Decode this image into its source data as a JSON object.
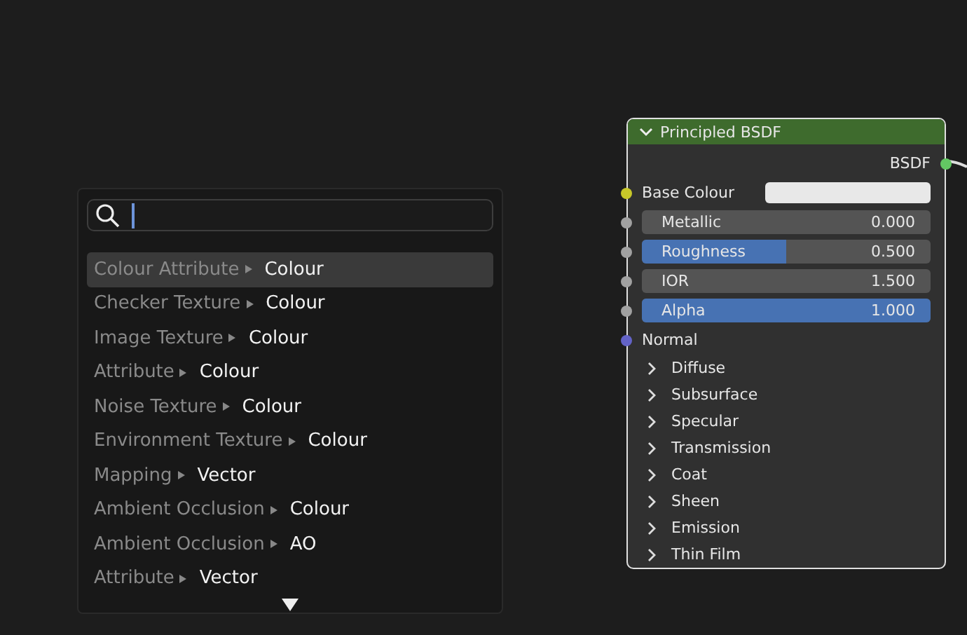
{
  "search_menu": {
    "items": [
      {
        "source": "Colour Attribute",
        "output": "Colour",
        "selected": true
      },
      {
        "source": "Checker Texture",
        "output": "Colour",
        "selected": false
      },
      {
        "source": "Image Texture",
        "output": "Colour",
        "selected": false
      },
      {
        "source": "Attribute",
        "output": "Colour",
        "selected": false
      },
      {
        "source": "Noise Texture",
        "output": "Colour",
        "selected": false
      },
      {
        "source": "Environment Texture",
        "output": "Colour",
        "selected": false
      },
      {
        "source": "Mapping",
        "output": "Vector",
        "selected": false
      },
      {
        "source": "Ambient Occlusion",
        "output": "Colour",
        "selected": false
      },
      {
        "source": "Ambient Occlusion",
        "output": "AO",
        "selected": false
      },
      {
        "source": "Attribute",
        "output": "Vector",
        "selected": false
      }
    ]
  },
  "node": {
    "title": "Principled BSDF",
    "expanded": true,
    "output": {
      "label": "BSDF",
      "color": "#63c763"
    },
    "inputs": [
      {
        "kind": "color",
        "label": "Base Colour",
        "color": "#c7c729"
      },
      {
        "kind": "slider",
        "label": "Metallic",
        "value": "0.000",
        "color": "#a1a1a1"
      },
      {
        "kind": "slider",
        "label": "Roughness",
        "value": "0.500",
        "level": 0.5,
        "color": "#a1a1a1"
      },
      {
        "kind": "number",
        "label": "IOR",
        "value": "1.500",
        "color": "#a1a1a1"
      },
      {
        "kind": "slider",
        "label": "Alpha",
        "value": "1.000",
        "level": 1,
        "color": "#a1a1a1"
      },
      {
        "kind": "vector",
        "label": "Normal",
        "color": "#6363c7"
      }
    ],
    "panels": [
      {
        "label": "Diffuse",
        "expanded": false
      },
      {
        "label": "Subsurface",
        "expanded": false
      },
      {
        "label": "Specular",
        "expanded": false
      },
      {
        "label": "Transmission",
        "expanded": false
      },
      {
        "label": "Coat",
        "expanded": false
      },
      {
        "label": "Sheen",
        "expanded": false
      },
      {
        "label": "Emission",
        "expanded": false
      },
      {
        "label": "Thin Film",
        "expanded": false
      }
    ]
  }
}
